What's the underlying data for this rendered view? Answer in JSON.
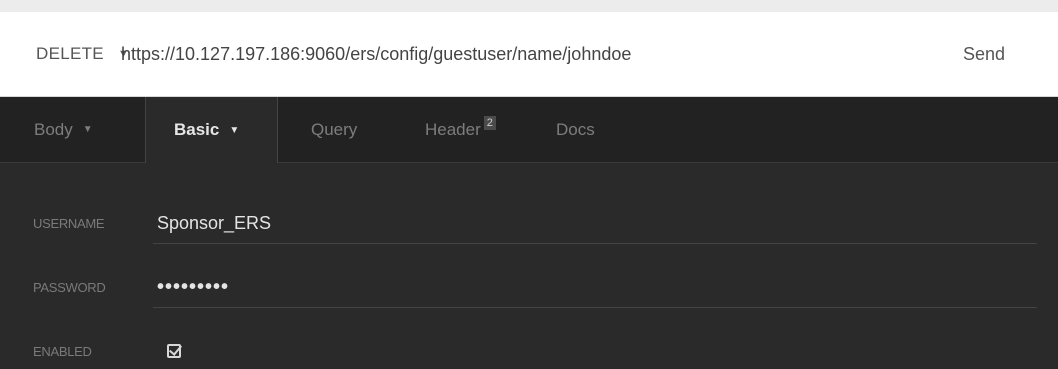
{
  "request": {
    "method": "DELETE",
    "url": "https://10.127.197.186:9060/ers/config/guestuser/name/johndoe",
    "send_label": "Send"
  },
  "tabs": [
    {
      "label": "Body",
      "active": false
    },
    {
      "label": "Basic",
      "active": true
    },
    {
      "label": "Query",
      "active": false
    },
    {
      "label": "Header",
      "badge": "2",
      "active": false
    },
    {
      "label": "Docs",
      "active": false
    }
  ],
  "auth": {
    "username_label": "USERNAME",
    "username_value": "Sponsor_ERS",
    "password_label": "PASSWORD",
    "password_value": "•••••••••",
    "enabled_label": "ENABLED",
    "enabled": true
  },
  "colors": {
    "panel_bg": "#2a2a2a",
    "tabbar_bg": "#222222",
    "urlbar_bg": "#ffffff"
  }
}
